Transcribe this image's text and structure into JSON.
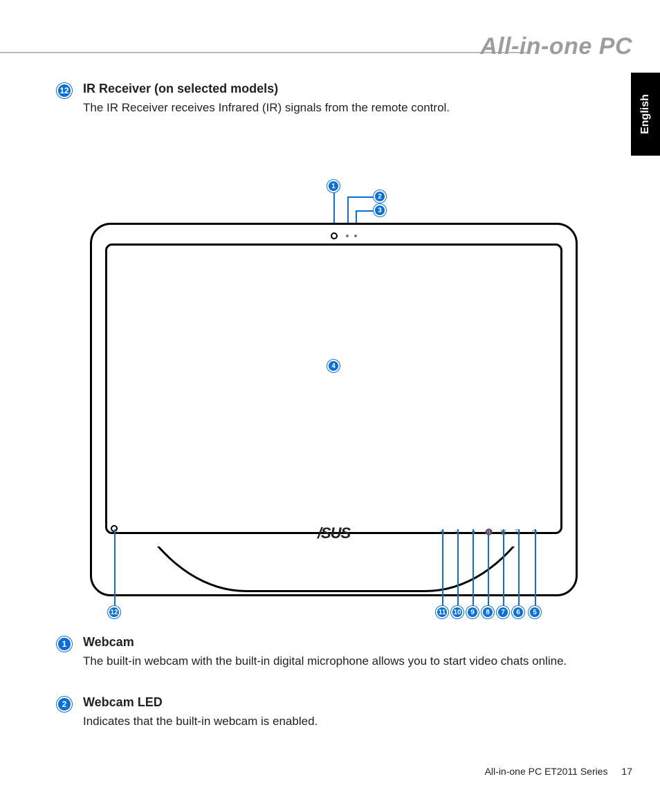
{
  "header": {
    "title": "All-in-one PC"
  },
  "language_tab": "English",
  "sections": {
    "s12": {
      "num": "12",
      "title": "IR Receiver (on selected models)",
      "body": "The IR Receiver receives Infrared (IR) signals from the remote control."
    },
    "s1": {
      "num": "1",
      "title": "Webcam",
      "body": "The built-in webcam with the built-in digital microphone allows you to start video chats online."
    },
    "s2": {
      "num": "2",
      "title": "Webcam LED",
      "body": "Indicates that the built-in webcam is enabled."
    }
  },
  "diagram": {
    "logo": "/SUS",
    "callouts": {
      "top": {
        "c1": "1",
        "c2": "2",
        "c3": "3"
      },
      "center": {
        "c4": "4"
      },
      "bottom": {
        "c5": "5",
        "c6": "6",
        "c7": "7",
        "c8": "8",
        "c9": "9",
        "c10": "10",
        "c11": "11",
        "c12": "12"
      }
    },
    "button_icons": {
      "b11": "☀",
      "b10": "↕",
      "b9": "◄",
      "b8": "🔇",
      "b7": "▣",
      "b6": "⎘",
      "b5": "⏻"
    }
  },
  "footer": {
    "series": "All-in-one PC ET2011 Series",
    "page": "17"
  }
}
